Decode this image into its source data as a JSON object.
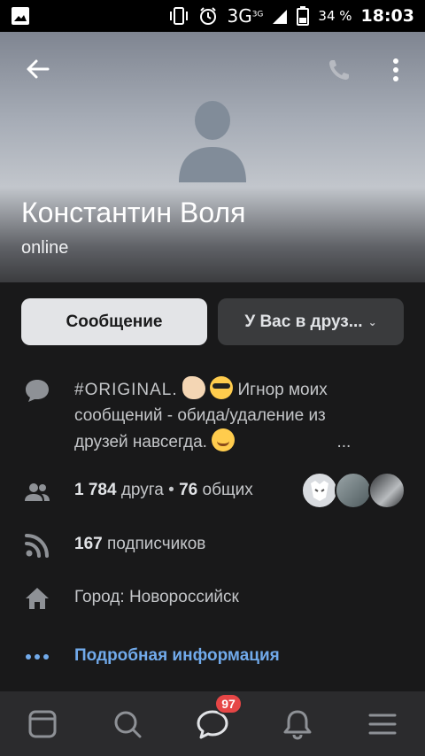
{
  "status_bar": {
    "network": "3G",
    "network_sup": "3G",
    "battery_percent": "34 %",
    "time": "18:03",
    "icons": [
      "image-icon",
      "vibrate-icon",
      "alarm-icon",
      "signal-icon",
      "battery-icon"
    ]
  },
  "header": {
    "name": "Константин Воля",
    "status": "online",
    "icons": [
      "back-arrow-icon",
      "phone-icon",
      "more-vertical-icon",
      "avatar-placeholder-icon"
    ]
  },
  "actions": {
    "message_label": "Сообщение",
    "friends_label": "У Вас в друз..."
  },
  "info": {
    "bio_tag": "#ORIGINAL.",
    "bio_text_1": "Игнор моих",
    "bio_text_2": "сообщений - обида/удаление из",
    "bio_text_3": "друзей навсегда.",
    "bio_ellipsis": "...",
    "friends_count": "1 784",
    "friends_word": "друга",
    "mutual_count": "76",
    "mutual_word": "общих",
    "subscribers_count": "167",
    "subscribers_word": "подписчиков",
    "city": "Город: Новороссийск",
    "details_link": "Подробная информация"
  },
  "bottom_nav": {
    "items": [
      "news-icon",
      "search-icon",
      "messages-icon",
      "notifications-icon",
      "menu-icon"
    ],
    "messages_badge": "97",
    "active": "messages-icon"
  },
  "colors": {
    "background": "#19191a",
    "link": "#71aaeb",
    "badge": "#e64646",
    "message_button": "#e3e4e7",
    "friends_button": "#3a3b3d"
  }
}
